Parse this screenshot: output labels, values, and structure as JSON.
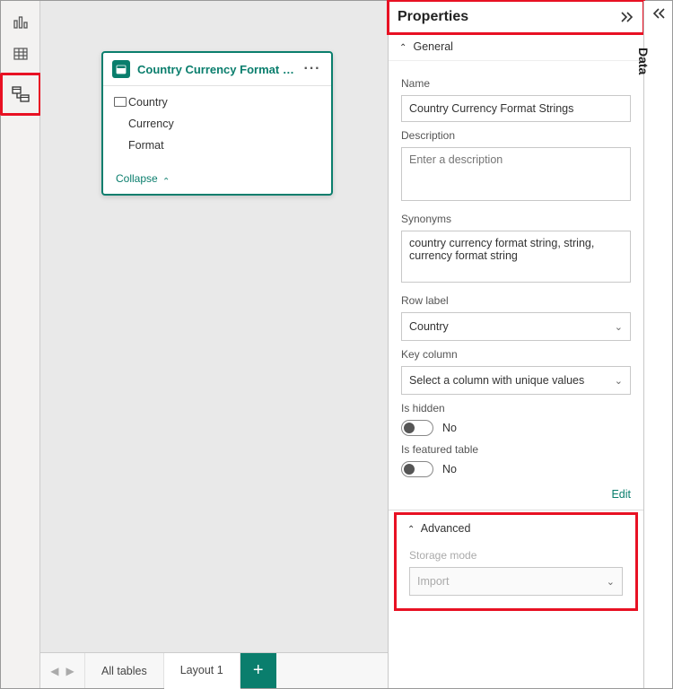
{
  "rail": {
    "report_tooltip": "Report view",
    "data_tooltip": "Data view",
    "model_tooltip": "Model view"
  },
  "table_card": {
    "title": "Country Currency Format Strings",
    "fields": [
      "Country",
      "Currency",
      "Format"
    ],
    "collapse_label": "Collapse"
  },
  "bottom": {
    "tab_all": "All tables",
    "tab_layout": "Layout 1"
  },
  "properties": {
    "title": "Properties",
    "sections": {
      "general": "General",
      "advanced": "Advanced"
    },
    "name_label": "Name",
    "name_value": "Country Currency Format Strings",
    "description_label": "Description",
    "description_placeholder": "Enter a description",
    "synonyms_label": "Synonyms",
    "synonyms_value": "country currency format string, string, currency format string",
    "row_label_label": "Row label",
    "row_label_value": "Country",
    "key_column_label": "Key column",
    "key_column_value": "Select a column with unique values",
    "is_hidden_label": "Is hidden",
    "is_hidden_value": "No",
    "is_featured_label": "Is featured table",
    "is_featured_value": "No",
    "edit_label": "Edit",
    "storage_mode_label": "Storage mode",
    "storage_mode_value": "Import"
  },
  "data_pane": {
    "title": "Data"
  }
}
